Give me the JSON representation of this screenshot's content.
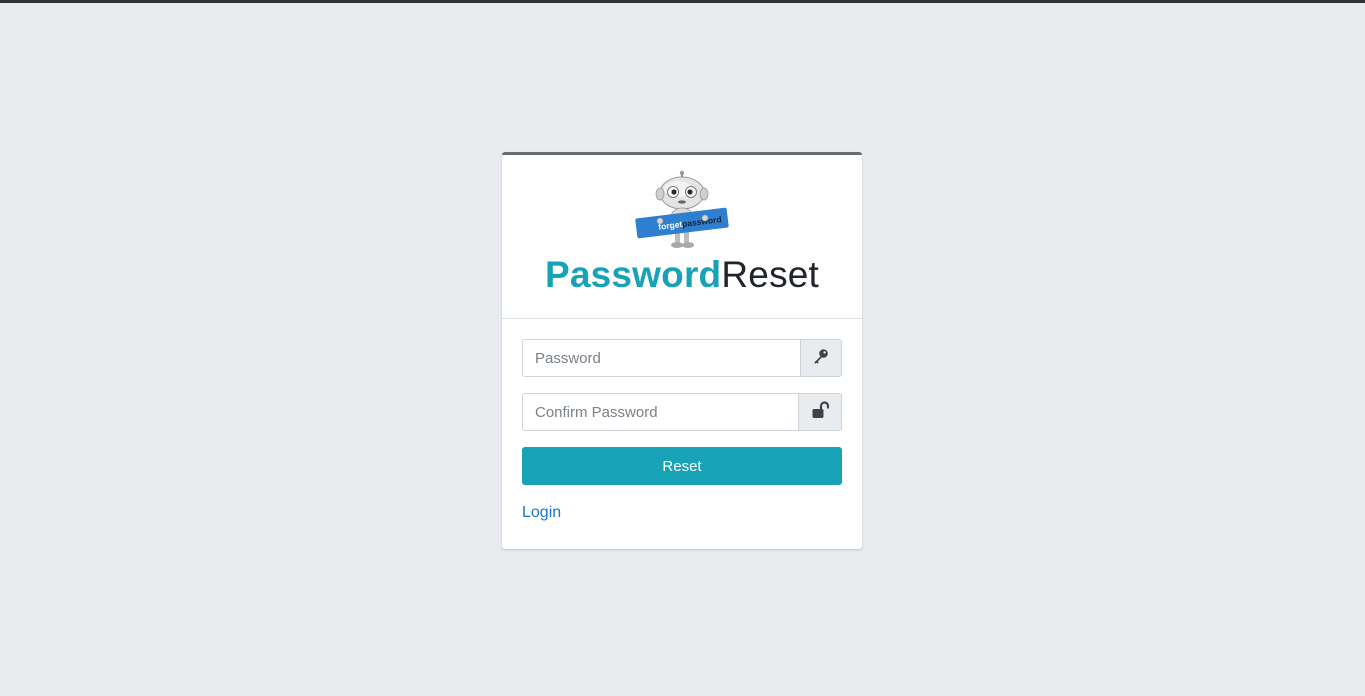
{
  "brand": {
    "title_strong": "Password",
    "title_light": "Reset",
    "mascot_sign_text_1": "forget",
    "mascot_sign_text_2": "password",
    "colors": {
      "accent": "#17a2b8",
      "background": "#e8ecef",
      "card_top_border": "#666c72"
    }
  },
  "form": {
    "password": {
      "placeholder": "Password",
      "value": "",
      "icon": "key-icon"
    },
    "confirm_password": {
      "placeholder": "Confirm Password",
      "value": "",
      "icon": "unlock-icon"
    },
    "reset_label": "Reset"
  },
  "footer": {
    "login_label": "Login"
  }
}
